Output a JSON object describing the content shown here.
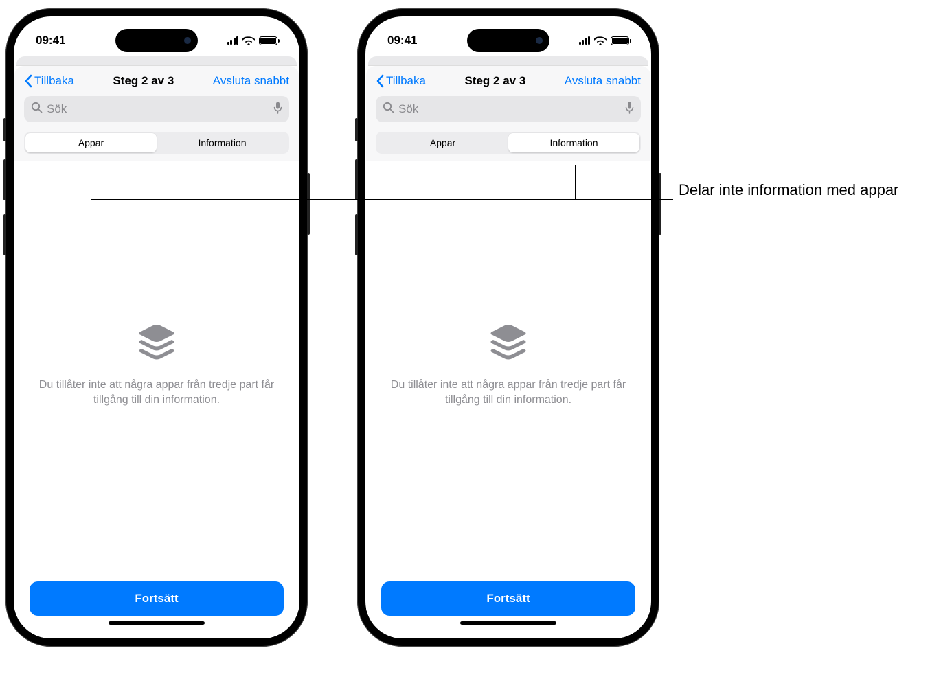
{
  "status": {
    "time": "09:41"
  },
  "nav": {
    "back": "Tillbaka",
    "title": "Steg 2 av 3",
    "action": "Avsluta snabbt"
  },
  "search": {
    "placeholder": "Sök"
  },
  "segments": {
    "apps": "Appar",
    "info": "Information"
  },
  "empty": {
    "text": "Du tillåter inte att några appar från tredje part får tillgång till din information."
  },
  "footer": {
    "continue": "Fortsätt"
  },
  "callout": {
    "text": "Delar inte information med appar"
  }
}
